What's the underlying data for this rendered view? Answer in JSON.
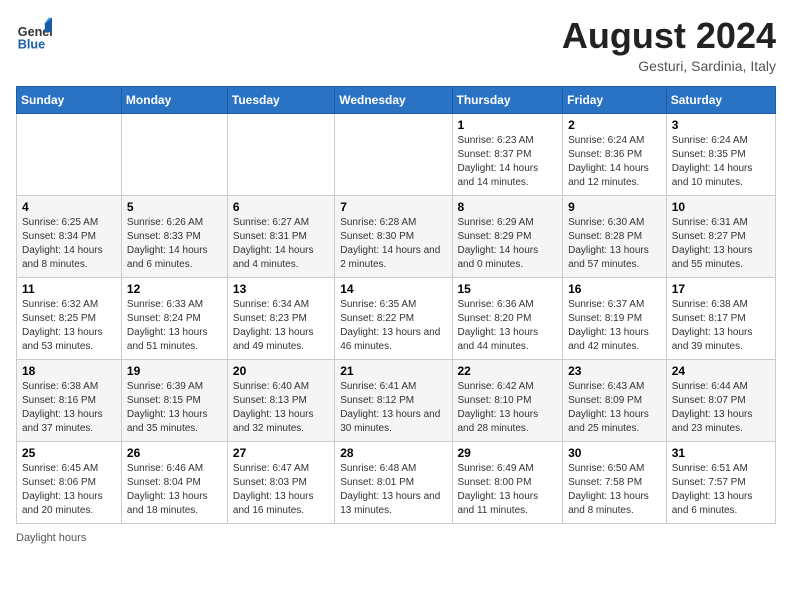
{
  "header": {
    "logo_general": "General",
    "logo_blue": "Blue",
    "month_year": "August 2024",
    "location": "Gesturi, Sardinia, Italy"
  },
  "weekdays": [
    "Sunday",
    "Monday",
    "Tuesday",
    "Wednesday",
    "Thursday",
    "Friday",
    "Saturday"
  ],
  "weeks": [
    [
      null,
      null,
      null,
      null,
      {
        "day": "1",
        "sunrise": "6:23 AM",
        "sunset": "8:37 PM",
        "daylight": "14 hours and 14 minutes."
      },
      {
        "day": "2",
        "sunrise": "6:24 AM",
        "sunset": "8:36 PM",
        "daylight": "14 hours and 12 minutes."
      },
      {
        "day": "3",
        "sunrise": "6:24 AM",
        "sunset": "8:35 PM",
        "daylight": "14 hours and 10 minutes."
      }
    ],
    [
      {
        "day": "4",
        "sunrise": "6:25 AM",
        "sunset": "8:34 PM",
        "daylight": "14 hours and 8 minutes."
      },
      {
        "day": "5",
        "sunrise": "6:26 AM",
        "sunset": "8:33 PM",
        "daylight": "14 hours and 6 minutes."
      },
      {
        "day": "6",
        "sunrise": "6:27 AM",
        "sunset": "8:31 PM",
        "daylight": "14 hours and 4 minutes."
      },
      {
        "day": "7",
        "sunrise": "6:28 AM",
        "sunset": "8:30 PM",
        "daylight": "14 hours and 2 minutes."
      },
      {
        "day": "8",
        "sunrise": "6:29 AM",
        "sunset": "8:29 PM",
        "daylight": "14 hours and 0 minutes."
      },
      {
        "day": "9",
        "sunrise": "6:30 AM",
        "sunset": "8:28 PM",
        "daylight": "13 hours and 57 minutes."
      },
      {
        "day": "10",
        "sunrise": "6:31 AM",
        "sunset": "8:27 PM",
        "daylight": "13 hours and 55 minutes."
      }
    ],
    [
      {
        "day": "11",
        "sunrise": "6:32 AM",
        "sunset": "8:25 PM",
        "daylight": "13 hours and 53 minutes."
      },
      {
        "day": "12",
        "sunrise": "6:33 AM",
        "sunset": "8:24 PM",
        "daylight": "13 hours and 51 minutes."
      },
      {
        "day": "13",
        "sunrise": "6:34 AM",
        "sunset": "8:23 PM",
        "daylight": "13 hours and 49 minutes."
      },
      {
        "day": "14",
        "sunrise": "6:35 AM",
        "sunset": "8:22 PM",
        "daylight": "13 hours and 46 minutes."
      },
      {
        "day": "15",
        "sunrise": "6:36 AM",
        "sunset": "8:20 PM",
        "daylight": "13 hours and 44 minutes."
      },
      {
        "day": "16",
        "sunrise": "6:37 AM",
        "sunset": "8:19 PM",
        "daylight": "13 hours and 42 minutes."
      },
      {
        "day": "17",
        "sunrise": "6:38 AM",
        "sunset": "8:17 PM",
        "daylight": "13 hours and 39 minutes."
      }
    ],
    [
      {
        "day": "18",
        "sunrise": "6:38 AM",
        "sunset": "8:16 PM",
        "daylight": "13 hours and 37 minutes."
      },
      {
        "day": "19",
        "sunrise": "6:39 AM",
        "sunset": "8:15 PM",
        "daylight": "13 hours and 35 minutes."
      },
      {
        "day": "20",
        "sunrise": "6:40 AM",
        "sunset": "8:13 PM",
        "daylight": "13 hours and 32 minutes."
      },
      {
        "day": "21",
        "sunrise": "6:41 AM",
        "sunset": "8:12 PM",
        "daylight": "13 hours and 30 minutes."
      },
      {
        "day": "22",
        "sunrise": "6:42 AM",
        "sunset": "8:10 PM",
        "daylight": "13 hours and 28 minutes."
      },
      {
        "day": "23",
        "sunrise": "6:43 AM",
        "sunset": "8:09 PM",
        "daylight": "13 hours and 25 minutes."
      },
      {
        "day": "24",
        "sunrise": "6:44 AM",
        "sunset": "8:07 PM",
        "daylight": "13 hours and 23 minutes."
      }
    ],
    [
      {
        "day": "25",
        "sunrise": "6:45 AM",
        "sunset": "8:06 PM",
        "daylight": "13 hours and 20 minutes."
      },
      {
        "day": "26",
        "sunrise": "6:46 AM",
        "sunset": "8:04 PM",
        "daylight": "13 hours and 18 minutes."
      },
      {
        "day": "27",
        "sunrise": "6:47 AM",
        "sunset": "8:03 PM",
        "daylight": "13 hours and 16 minutes."
      },
      {
        "day": "28",
        "sunrise": "6:48 AM",
        "sunset": "8:01 PM",
        "daylight": "13 hours and 13 minutes."
      },
      {
        "day": "29",
        "sunrise": "6:49 AM",
        "sunset": "8:00 PM",
        "daylight": "13 hours and 11 minutes."
      },
      {
        "day": "30",
        "sunrise": "6:50 AM",
        "sunset": "7:58 PM",
        "daylight": "13 hours and 8 minutes."
      },
      {
        "day": "31",
        "sunrise": "6:51 AM",
        "sunset": "7:57 PM",
        "daylight": "13 hours and 6 minutes."
      }
    ]
  ],
  "footer": {
    "daylight_label": "Daylight hours"
  }
}
